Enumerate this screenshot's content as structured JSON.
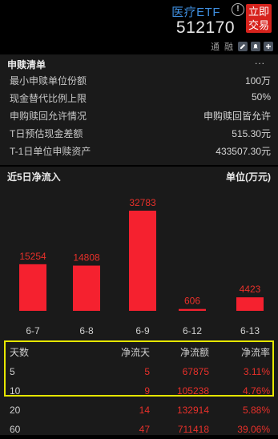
{
  "header": {
    "title": "医疗ETF",
    "code": "512170",
    "trade_button": "立即\n交易",
    "trade_line1": "立即",
    "trade_line2": "交易",
    "tag_tong": "通",
    "tag_rong": "融",
    "info_icon": "info-icon"
  },
  "creation_list": {
    "title": "申赎清单",
    "more": "...",
    "rows": [
      {
        "label": "最小申赎单位份额",
        "value": "100万"
      },
      {
        "label": "现金替代比例上限",
        "value": "50%"
      },
      {
        "label": "申购赎回允许情况",
        "value": "申购赎回皆允许"
      },
      {
        "label": "T日预估现金差额",
        "value": "515.30元"
      },
      {
        "label": "T-1日单位申赎资产",
        "value": "433507.30元"
      }
    ]
  },
  "inflow": {
    "title": "近5日净流入",
    "unit": "单位(万元)"
  },
  "chart_data": {
    "type": "bar",
    "title": "近5日净流入",
    "ylabel": "单位(万元)",
    "categories": [
      "6-7",
      "6-8",
      "6-9",
      "6-12",
      "6-13"
    ],
    "values": [
      15254,
      14808,
      32783,
      606,
      4423
    ],
    "bar_color": "#f5212f"
  },
  "table": {
    "headers": [
      "天数",
      "净流天",
      "净流额",
      "净流率"
    ],
    "rows": [
      {
        "days": "5",
        "flow_days": "5",
        "amount": "67875",
        "rate": "3.11%"
      },
      {
        "days": "10",
        "flow_days": "9",
        "amount": "105238",
        "rate": "4.76%"
      },
      {
        "days": "20",
        "flow_days": "14",
        "amount": "132914",
        "rate": "5.88%"
      },
      {
        "days": "60",
        "flow_days": "47",
        "amount": "711418",
        "rate": "39.06%"
      }
    ]
  },
  "colors": {
    "accent_blue": "#3f8fe0",
    "trade_red": "#d7231d",
    "highlight_yellow": "#e6e600",
    "value_red": "#e8302a"
  }
}
